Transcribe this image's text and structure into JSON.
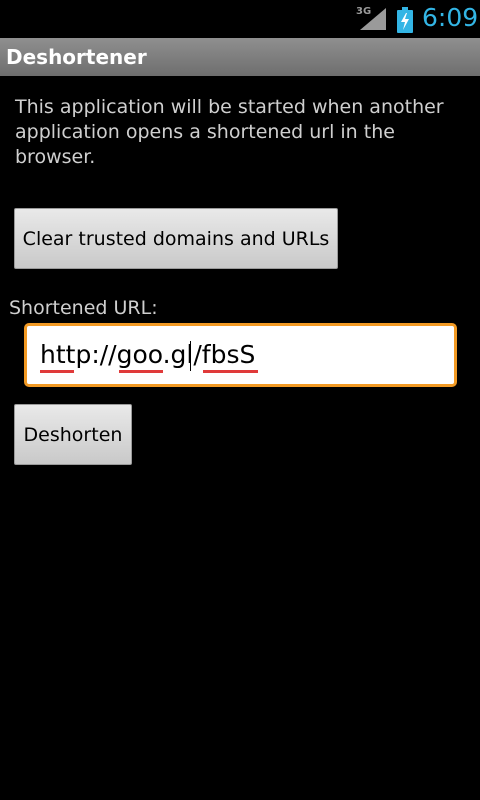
{
  "status_bar": {
    "network_type": "3G",
    "time": "6:09",
    "clock_color": "#33b5e5"
  },
  "title_bar": {
    "title": "Deshortener"
  },
  "main": {
    "description": "This application will be started when another application opens a shortened url in the browser.",
    "clear_button_label": "Clear trusted domains and URLs",
    "url_label": "Shortened URL:",
    "url_value": "http://goo.gl/fbsS",
    "deshorten_button_label": "Deshorten"
  },
  "colors": {
    "accent_focus": "#f29a24",
    "title_bar": "#7d7d7d",
    "spellcheck": "#e03a3a"
  }
}
